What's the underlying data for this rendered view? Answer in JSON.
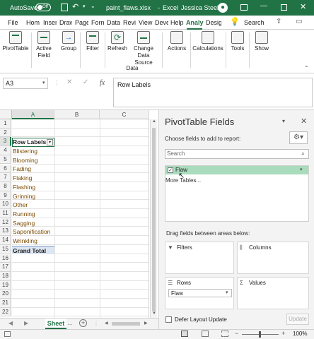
{
  "titlebar": {
    "autosave_label": "AutoSave",
    "autosave_state": "Off",
    "filename": "paint_flaws.xlsx",
    "app": "Excel",
    "user": "Jessica Steele"
  },
  "tabs": [
    "File",
    "Hom",
    "Inser",
    "Draw",
    "Page",
    "Forn",
    "Data",
    "Revi",
    "View",
    "Deve",
    "Help",
    "Analy",
    "Desig"
  ],
  "active_tab": "Analy",
  "search_label": "Search",
  "ribbon": {
    "buttons": [
      {
        "label": "PivotTable",
        "label2": ""
      },
      {
        "label": "Active",
        "label2": "Field"
      },
      {
        "label": "Group",
        "label2": ""
      },
      {
        "label": "Filter",
        "label2": ""
      },
      {
        "label": "Refresh",
        "label2": ""
      },
      {
        "label": "Change Data",
        "label2": "Source"
      },
      {
        "label": "Actions",
        "label2": ""
      },
      {
        "label": "Calculations",
        "label2": ""
      },
      {
        "label": "Tools",
        "label2": ""
      },
      {
        "label": "Show",
        "label2": ""
      }
    ],
    "group_label": "Data"
  },
  "formula": {
    "namebox": "A3",
    "fx": "fx",
    "content": "Row Labels"
  },
  "grid": {
    "columns": [
      "A",
      "B",
      "C"
    ],
    "rows": [
      "1",
      "2",
      "3",
      "4",
      "5",
      "6",
      "7",
      "8",
      "9",
      "10",
      "11",
      "12",
      "13",
      "14",
      "15",
      "16",
      "17",
      "18",
      "19",
      "20",
      "21",
      "22"
    ],
    "pivot_header": "Row Labels",
    "items": [
      "Blistering",
      "Blooming",
      "Fading",
      "Flaking",
      "Flashing",
      "Grinning",
      "Other",
      "Running",
      "Sagging",
      "Saponification",
      "Wrinkling"
    ],
    "grand_total": "Grand Total"
  },
  "sheet_tab": "Sheet",
  "pane": {
    "title": "PivotTable Fields",
    "choose_label": "Choose fields to add to report:",
    "search_placeholder": "Search",
    "field": "Flaw",
    "more_tables": "More Tables...",
    "drag_label": "Drag fields between areas below:",
    "filters": "Filters",
    "columns": "Columns",
    "rows": "Rows",
    "values": "Values",
    "rows_field": "Flaw",
    "defer": "Defer Layout Update",
    "update": "Update"
  },
  "status": {
    "zoom": "100%"
  },
  "colors": {
    "excel_green": "#217346",
    "pivot_highlight": "#a9dbbd",
    "item_text": "#7a4a00"
  }
}
